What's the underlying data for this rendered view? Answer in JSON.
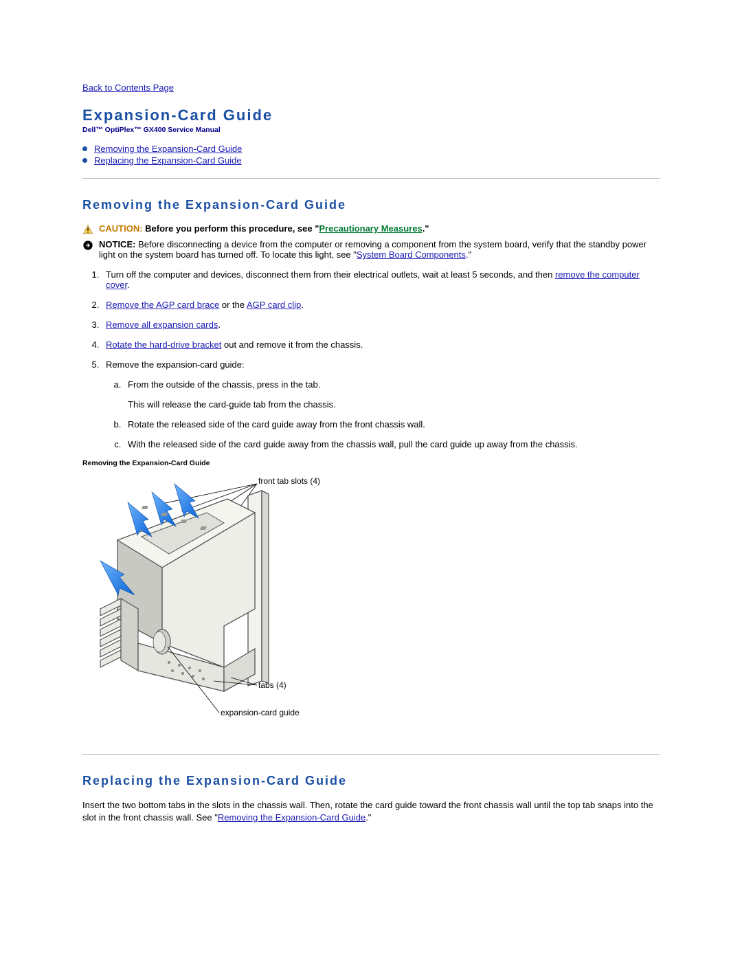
{
  "nav": {
    "back_link": "Back to Contents Page"
  },
  "title": "Expansion-Card Guide",
  "subtitle": "Dell™ OptiPlex™ GX400 Service Manual",
  "toc": {
    "items": [
      {
        "label": "Removing the Expansion-Card Guide"
      },
      {
        "label": "Replacing the Expansion-Card Guide"
      }
    ]
  },
  "section1": {
    "heading": "Removing the Expansion-Card Guide",
    "caution": {
      "label": "CAUTION:",
      "text_before": " Before you perform this procedure, see \"",
      "link": "Precautionary Measures",
      "text_after": ".\""
    },
    "notice": {
      "label": "NOTICE:",
      "text_before": " Before disconnecting a device from the computer or removing a component from the system board, verify that the standby power light on the system board has turned off. To locate this light, see \"",
      "link": "System Board Components",
      "text_after": ".\""
    },
    "steps": {
      "s1": {
        "pre": "Turn off the computer and devices, disconnect them from their electrical outlets, wait at least 5 seconds, and then ",
        "link": "remove the computer cover",
        "post": "."
      },
      "s2": {
        "link1": "Remove the AGP card brace",
        "mid": " or the ",
        "link2": "AGP card clip",
        "post": "."
      },
      "s3": {
        "link": "Remove all expansion cards",
        "post": "."
      },
      "s4": {
        "link": "Rotate the hard-drive bracket",
        "post": " out and remove it from the chassis."
      },
      "s5": {
        "intro": "Remove the expansion-card guide:",
        "a": "From the outside of the chassis, press in the tab.",
        "a_note": "This will release the card-guide tab from the chassis.",
        "b": "Rotate the released side of the card guide away from the front chassis wall.",
        "c": "With the released side of the card guide away from the chassis wall, pull the card guide up away from the chassis."
      }
    },
    "figure": {
      "caption": "Removing the Expansion-Card Guide",
      "label_front": "front tab slots (4)",
      "label_tabs": "tabs (4)",
      "label_guide": "expansion-card guide"
    }
  },
  "section2": {
    "heading": "Replacing the Expansion-Card Guide",
    "p_pre": "Insert the two bottom tabs in the slots in the chassis wall. Then, rotate the card guide toward the front chassis wall until the top tab snaps into the slot in the front chassis wall. See \"",
    "p_link": "Removing the Expansion-Card Guide",
    "p_post": ".\""
  }
}
